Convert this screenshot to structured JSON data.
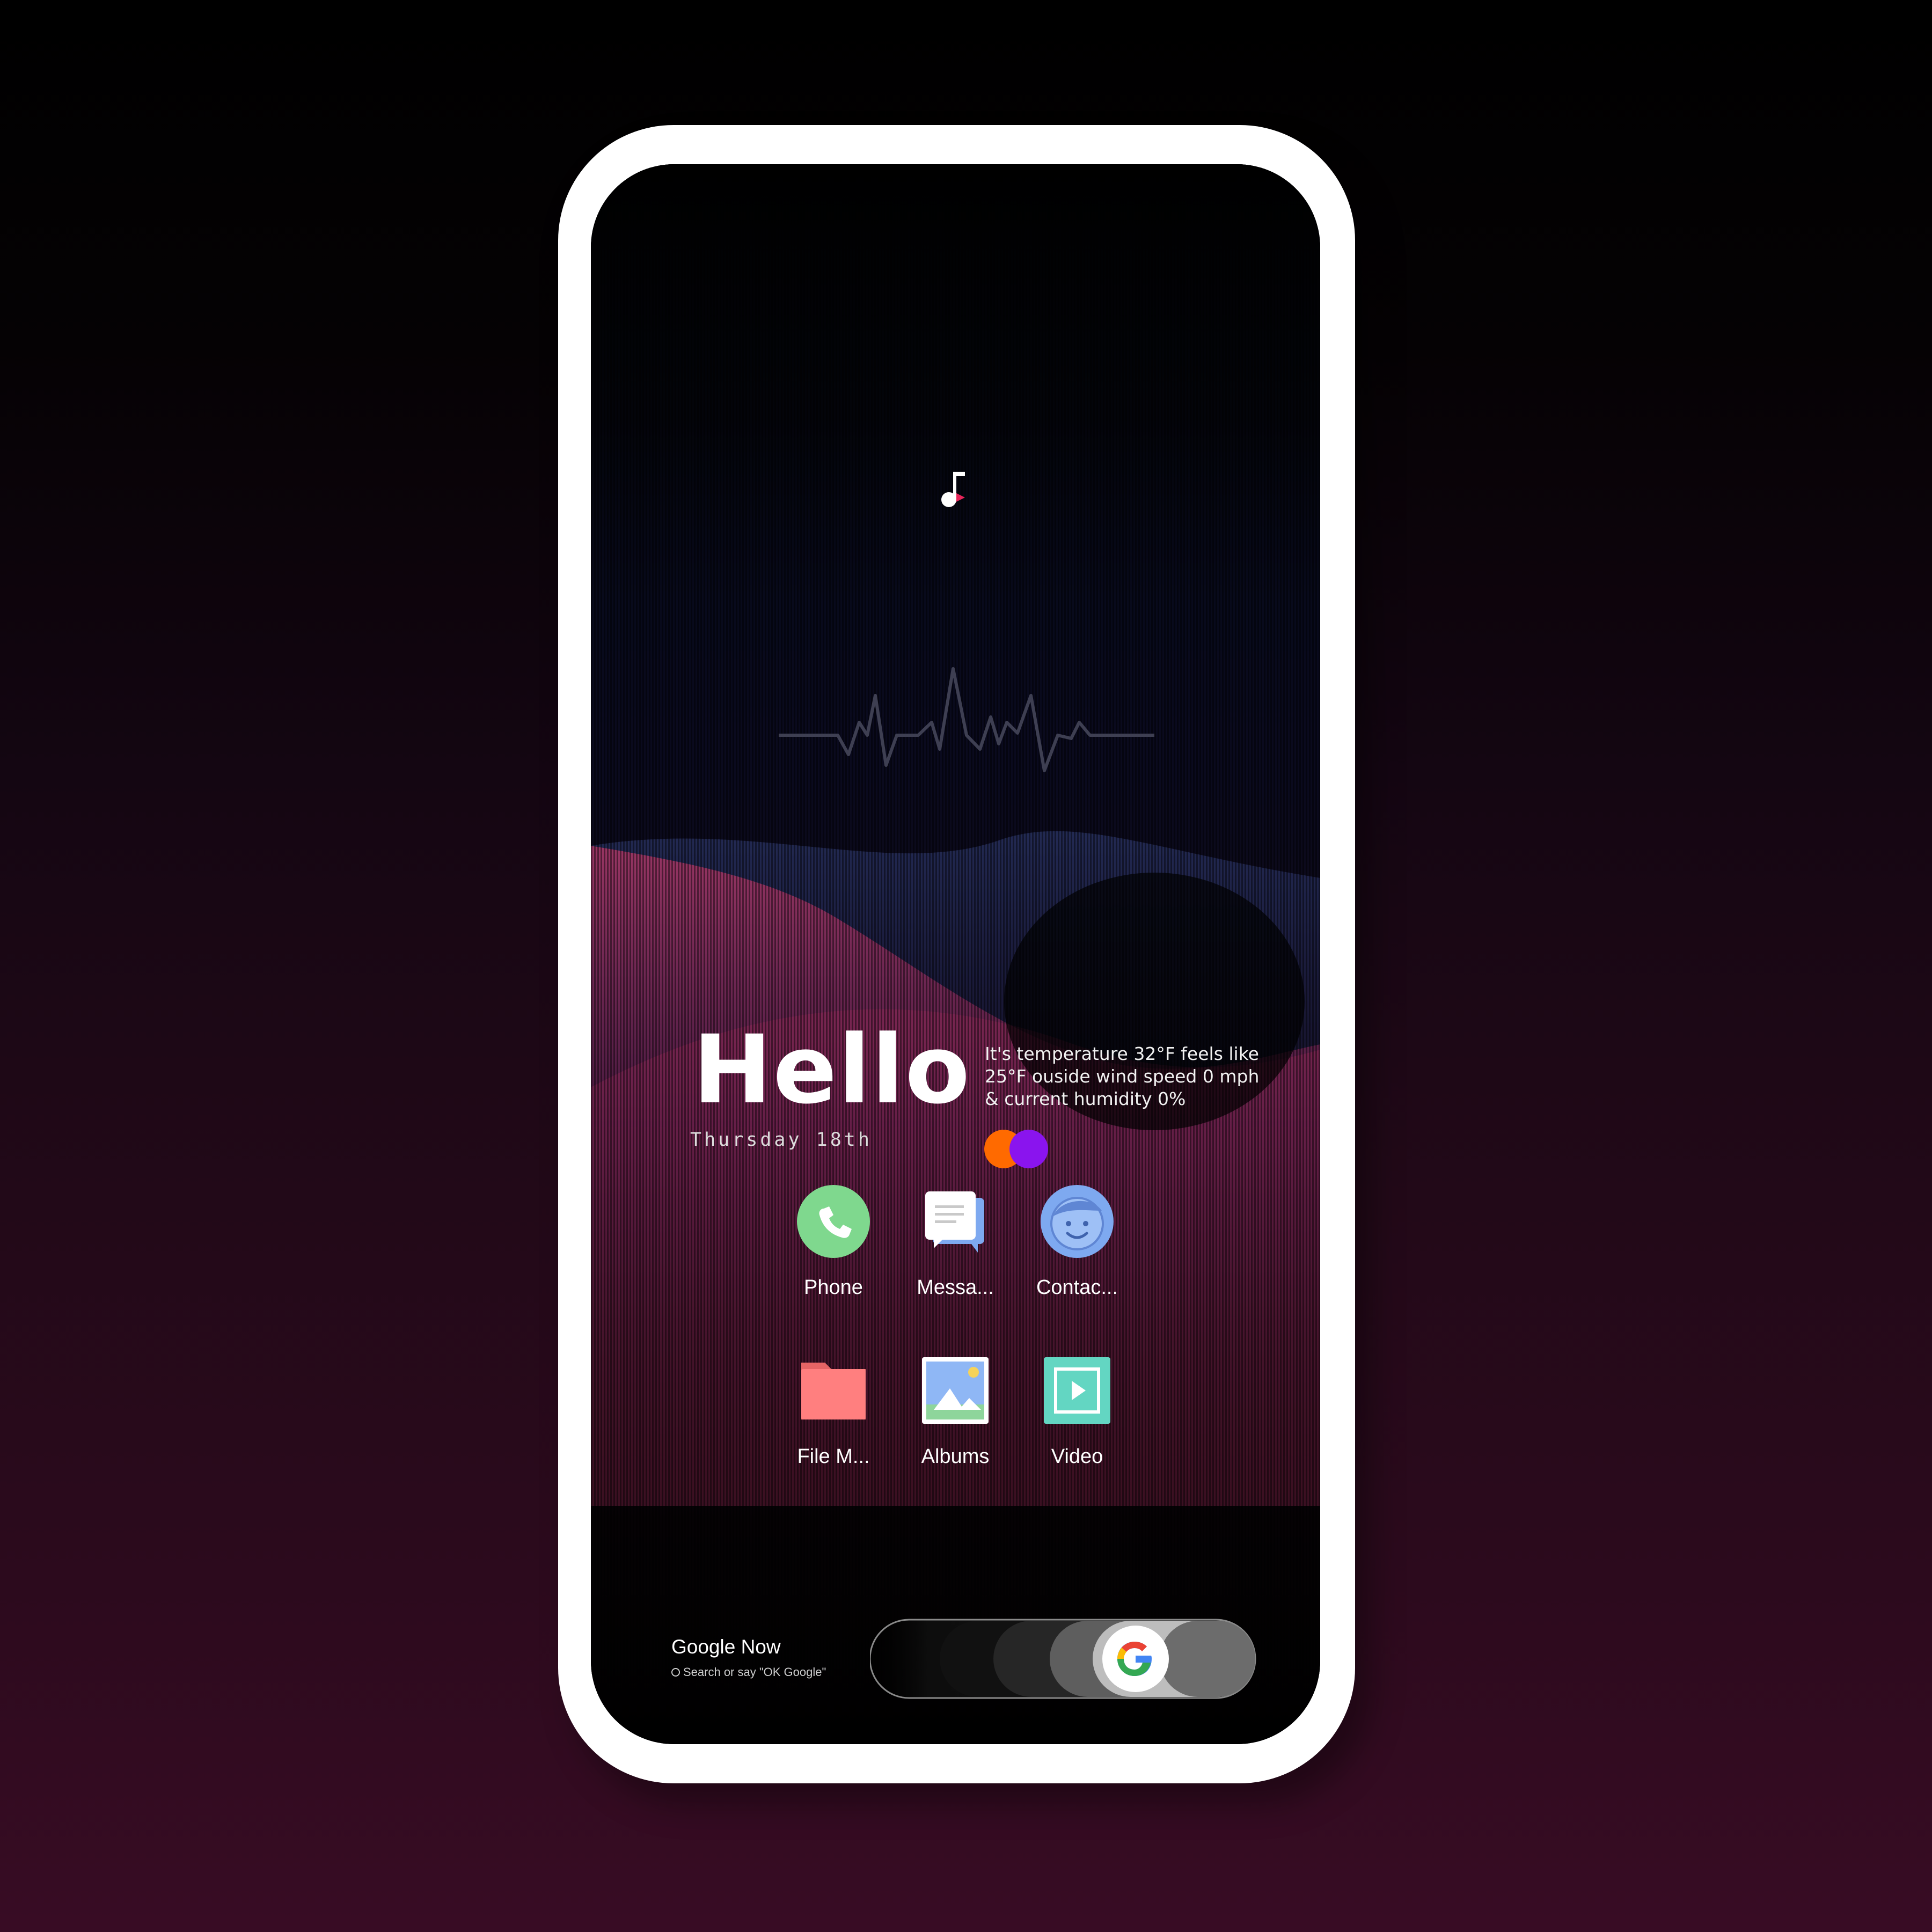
{
  "home": {
    "greeting": "Hello",
    "date": "Thursday 18th",
    "weather": "It's  temperature 32°F feels like 25°F ouside wind speed 0 mph & current humidity 0%"
  },
  "apps": [
    {
      "label": "Phone",
      "icon": "phone-icon"
    },
    {
      "label": "Messa...",
      "icon": "messages-icon"
    },
    {
      "label": "Contac...",
      "icon": "contacts-icon"
    },
    {
      "label": "File M...",
      "icon": "file-manager-icon"
    },
    {
      "label": "Albums",
      "icon": "albums-icon"
    },
    {
      "label": "Video",
      "icon": "video-icon"
    }
  ],
  "google_widget": {
    "title": "Google Now",
    "subtitle": "Search or say \"OK Google\""
  },
  "colors": {
    "phone": "#7fd88e",
    "messages_back": "#7ea9f0",
    "contacts": "#7ea9f0",
    "file_manager": "#ff7f7f",
    "video": "#63d6c2",
    "dot_orange": "#ff6a00",
    "dot_purple": "#8a14ee"
  }
}
